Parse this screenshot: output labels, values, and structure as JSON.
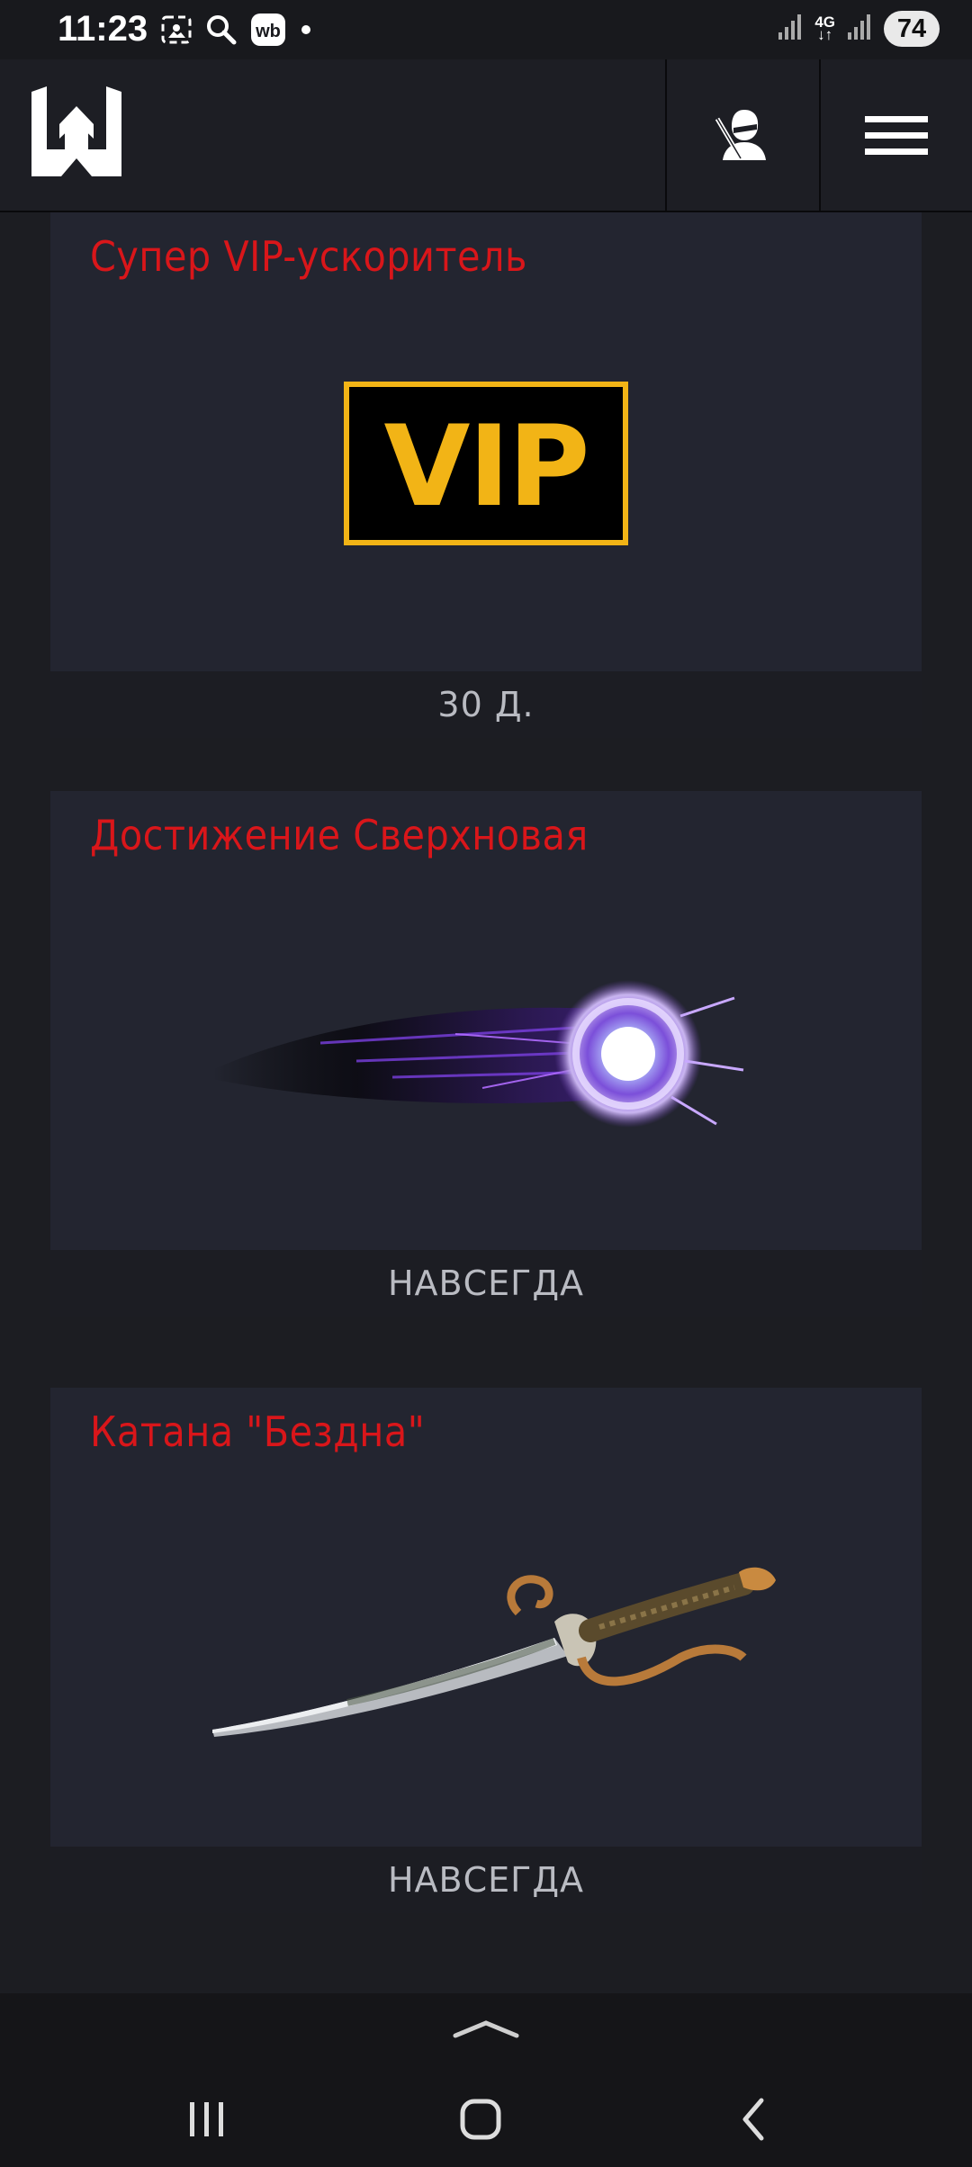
{
  "status_bar": {
    "time": "11:23",
    "network": "4G",
    "battery": "74"
  },
  "header": {
    "logo_icon": "warface-logo-icon",
    "profile_icon": "soldier-profile-icon",
    "menu_icon": "hamburger-menu-icon"
  },
  "items": [
    {
      "title": "Супер VIP-ускоритель",
      "duration": "30 Д.",
      "image": "vip-badge",
      "badge_text": "VIP"
    },
    {
      "title": "Достижение Сверхновая",
      "duration": "НАВСЕГДА",
      "image": "supernova-emblem"
    },
    {
      "title": "Катана \"Бездна\"",
      "duration": "НАВСЕГДА",
      "image": "katana-sword"
    }
  ],
  "colors": {
    "title_red": "#d9161a",
    "vip_gold": "#f2b416",
    "card_bg": "#232530",
    "page_bg": "#1c1d22"
  },
  "system_nav": {
    "recents_icon": "recents-icon",
    "home_icon": "home-icon",
    "back_icon": "back-icon",
    "expand_icon": "chevron-up-icon"
  }
}
